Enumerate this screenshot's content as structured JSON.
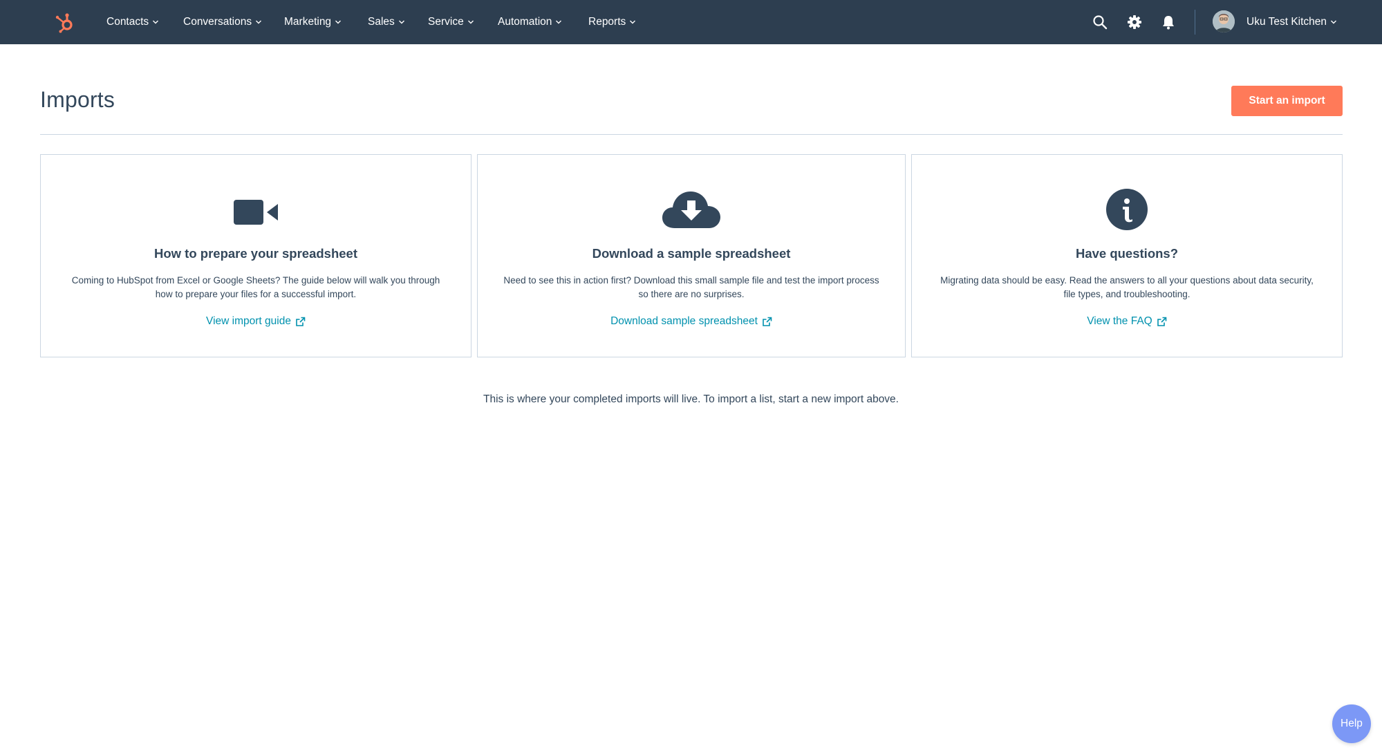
{
  "nav": {
    "logo_icon": "hubspot-sprocket-icon",
    "items": [
      {
        "label": "Contacts"
      },
      {
        "label": "Conversations"
      },
      {
        "label": "Marketing"
      },
      {
        "label": "Sales"
      },
      {
        "label": "Service"
      },
      {
        "label": "Automation"
      },
      {
        "label": "Reports"
      }
    ],
    "icons": [
      "search-icon",
      "gear-icon",
      "bell-icon"
    ],
    "account_name": "Uku Test Kitchen"
  },
  "page": {
    "title": "Imports",
    "start_button": "Start an import",
    "empty_message": "This is where your completed imports will live. To import a list, start a new import above."
  },
  "cards": [
    {
      "icon": "video-camera-icon",
      "title": "How to prepare your spreadsheet",
      "description": "Coming to HubSpot from Excel or Google Sheets? The guide below will walk you through how to prepare your files for a successful import.",
      "link": "View import guide"
    },
    {
      "icon": "cloud-download-icon",
      "title": "Download a sample spreadsheet",
      "description": "Need to see this in action first? Download this small sample file and test the import process so there are no surprises.",
      "link": "Download sample spreadsheet"
    },
    {
      "icon": "info-circle-icon",
      "title": "Have questions?",
      "description": "Migrating data should be easy. Read the answers to all your questions about data security, file types, and troubleshooting.",
      "link": "View the FAQ"
    }
  ],
  "help": {
    "label": "Help"
  },
  "colors": {
    "nav_bg": "#2d3e50",
    "accent": "#ff7a59",
    "link": "#0091ae",
    "text": "#33475b",
    "help_bg": "#7c98f6"
  }
}
